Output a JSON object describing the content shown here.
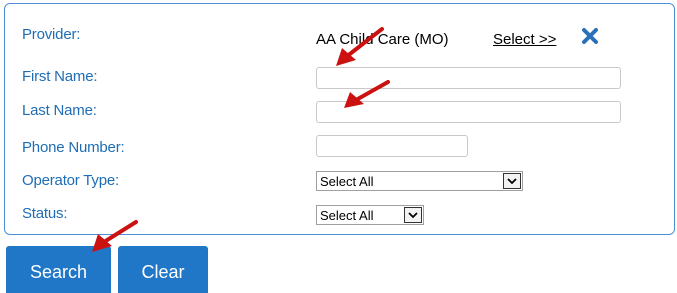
{
  "form": {
    "provider_label": "Provider:",
    "provider_value": "AA Child Care (MO)",
    "provider_select_link": "Select  >>",
    "first_name_label": "First Name:",
    "first_name_value": "",
    "last_name_label": "Last Name:",
    "last_name_value": "",
    "phone_label": "Phone Number:",
    "phone_value": "",
    "operator_type_label": "Operator Type:",
    "operator_type_selected": "Select All",
    "status_label": "Status:",
    "status_selected": "Select All"
  },
  "buttons": {
    "search_label": "Search",
    "clear_label": "Clear"
  },
  "colors": {
    "label_blue": "#1f6db5",
    "button_blue": "#2077c7",
    "panel_border": "#4a90d9",
    "annotation_arrow": "#cc1111",
    "clear_x_icon": "#2a6fb8"
  },
  "icons": {
    "provider_clear": "close-x-icon",
    "dropdown": "chevron-down-icon",
    "annotation": "red-arrow-annotation"
  }
}
